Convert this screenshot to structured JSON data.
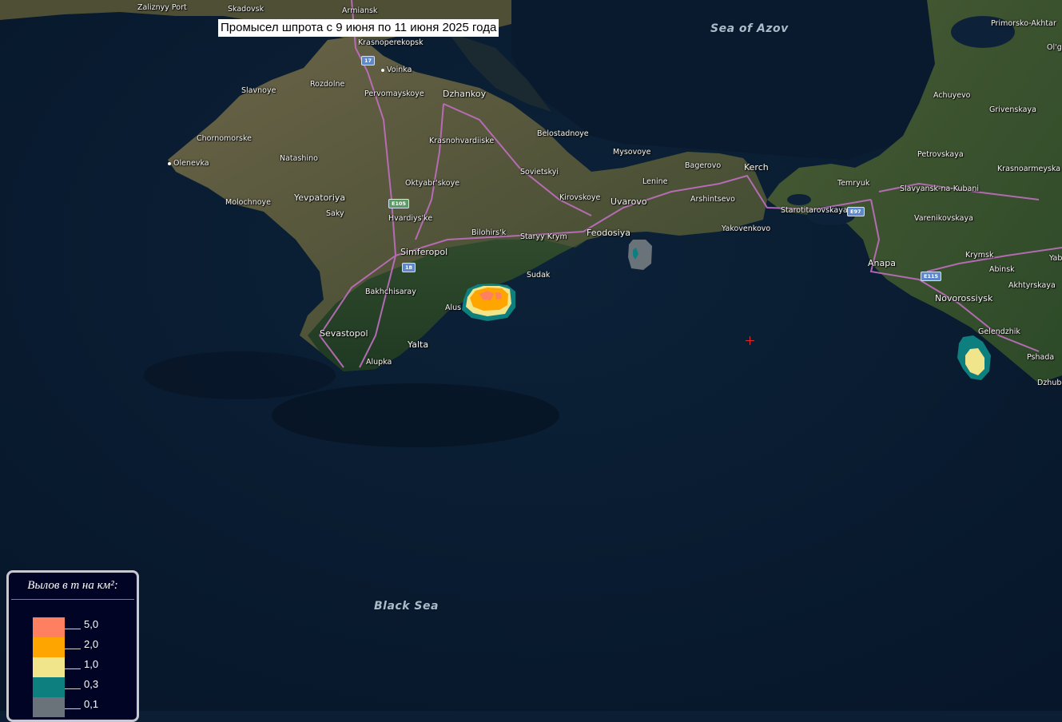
{
  "map": {
    "title": "Промысел шпрота с 9 июня по 11 июня 2025 года",
    "seas": {
      "azov": "Sea of Azov",
      "black": "Black Sea"
    },
    "places": {
      "zaliznyy_port": "Zaliznyy Port",
      "skadovsk": "Skadovsk",
      "armiansk": "Armiansk",
      "krasnoperekopsk": "Krasnoperekopsk",
      "voinka": "Voinka",
      "slavnoye": "Slavnoye",
      "rozdolne": "Rozdolne",
      "pervomayskoye": "Pervomayskoye",
      "dzhankoy": "Dzhankoy",
      "chornomorske": "Chornomorske",
      "belostadnoye": "Belostadnoye",
      "krasnohvardiiske": "Krasnohvardiiske",
      "natashino": "Natashino",
      "olenevka": "Olenevka",
      "mysovoye": "Mysovoye",
      "bagerovo": "Bagerovo",
      "kerch": "Kerch",
      "sovietskyi": "Sovietskyi",
      "oktyabrskoye": "Oktyabr'skoye",
      "lenine": "Lenine",
      "yevpatoriya": "Yevpatoriya",
      "molochnoye": "Molochnoye",
      "kirovskoye": "Kirovskoye",
      "uvarovo": "Uvarovo",
      "arshintsevo": "Arshintsevo",
      "saky": "Saky",
      "hvardiyske": "Hvardiys'ke",
      "bilohirsk": "Bilohirs'k",
      "staryy_krym": "Staryy Krym",
      "feodosiya": "Feodosiya",
      "yakovenkovo": "Yakovenkovo",
      "simferopol": "Simferopol",
      "sudak": "Sudak",
      "bakhchisaray": "Bakhchisaray",
      "alushta": "Alus",
      "sevastopol": "Sevastopol",
      "yalta": "Yalta",
      "alupka": "Alupka",
      "temryuk": "Temryuk",
      "starotitarovskaya": "Starotitarovskaya",
      "primorsko_akhtarsk": "Primorsko-Akhtar",
      "olgi": "Ol'gi",
      "achuyevo": "Achuyevo",
      "grivenskaya": "Grivenskaya",
      "petrovskaya": "Petrovskaya",
      "krasnoarmeyskaya": "Krasnoarmeyska",
      "slavyansk": "Slavyansk-na-Kubani",
      "varenikovskaya": "Varenikovskaya",
      "anapa": "Anapa",
      "krymsk": "Krymsk",
      "abinsk": "Abinsk",
      "akhtyrskaya": "Akhtyrskaya",
      "novorossiysk": "Novorossiysk",
      "gelendzhik": "Gelendzhik",
      "pshada": "Pshada",
      "dzhubga": "Dzhubg",
      "yab": "Yab"
    },
    "shields": {
      "r17": "17",
      "e105": "E105",
      "r18": "18",
      "e97": "E97",
      "e115": "E115"
    },
    "colors": {
      "sea": "#0b1e33",
      "land": "#3f4a30",
      "road": "#c06fc0",
      "crosshair": "#e0282e"
    }
  },
  "legend": {
    "title": "Вылов в т на км²:",
    "items": [
      {
        "label": "5,0",
        "color": "#ff7f61"
      },
      {
        "label": "2,0",
        "color": "#ffa500"
      },
      {
        "label": "1,0",
        "color": "#f1e58c"
      },
      {
        "label": "0,3",
        "color": "#0e7f7f"
      },
      {
        "label": "0,1",
        "color": "#6a727a"
      }
    ]
  }
}
